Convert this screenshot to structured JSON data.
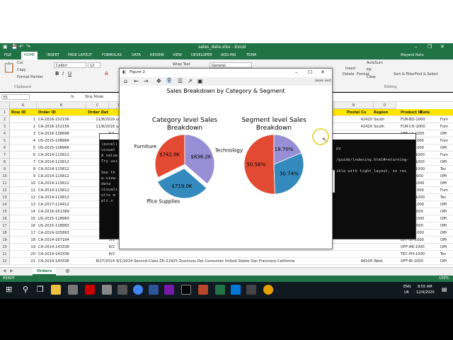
{
  "window": {
    "title": "sales_data.xlsx - Excel",
    "user": "Mayank Ratu"
  },
  "quick_access": {
    "excel_tab": "FILE"
  },
  "ribbon_tabs": [
    "FILE",
    "HOME",
    "INSERT",
    "PAGE LAYOUT",
    "FORMULAS",
    "DATA",
    "REVIEW",
    "VIEW",
    "DEVELOPER",
    "ADD-INS",
    "TEAM"
  ],
  "ribbon": {
    "cut": "Cut",
    "copy": "Copy",
    "format_painter": "Format Painter",
    "clipboard": "Clipboard",
    "font_name": "Calibri",
    "font_size": "12",
    "wrap_text": "Wrap Text",
    "number_format": "General",
    "autosum": "AutoSum",
    "fill": "Fill",
    "clear": "Clear",
    "sort_filter": "Sort & Filter",
    "find_select": "Find & Select",
    "editing": "Editing",
    "insert": "Insert",
    "delete": "Delete",
    "format": "Format"
  },
  "formula_bar": {
    "cell": "E1",
    "fx": "fx",
    "content": "Ship Mode"
  },
  "columns": [
    "A",
    "B",
    "C",
    "D",
    "E",
    "F",
    "G",
    "H",
    "I",
    "J",
    "K",
    "L",
    "M",
    "N",
    "O"
  ],
  "header_row": [
    "Row ID",
    "Order ID",
    "Order Dat",
    "",
    "",
    "",
    "",
    "",
    "",
    "",
    "Postal Co",
    "Region",
    "Product ID",
    "Cate"
  ],
  "rows": [
    {
      "n": "2",
      "id": "1",
      "order": "CA-2016-152156",
      "date": "11/8/2016",
      "tail": "ucky",
      "postal": "42420",
      "region": "South",
      "product": "FUR-BO-1000",
      "cat": "Furn"
    },
    {
      "n": "3",
      "id": "2",
      "order": "CA-2016-152156",
      "date": "11/8/2016",
      "tail": "ucky",
      "postal": "42420",
      "region": "South",
      "product": "FUR-CH-1000",
      "cat": "Furn"
    },
    {
      "n": "4",
      "id": "3",
      "order": "CA-2016-138688",
      "date": "6/1",
      "tail": "",
      "postal": "",
      "region": "",
      "product": "OFF-LA-1000",
      "cat": "Offi"
    },
    {
      "n": "5",
      "id": "4",
      "order": "US-2015-108966",
      "date": "10/1",
      "tail": "",
      "postal": "",
      "region": "",
      "product": "FUR-TA-1000",
      "cat": "Furn"
    },
    {
      "n": "6",
      "id": "5",
      "order": "US-2015-108966",
      "date": "10/1",
      "tail": "",
      "postal": "",
      "region": "",
      "product": "OFF-ST-1000",
      "cat": "Offi"
    },
    {
      "n": "7",
      "id": "6",
      "order": "CA-2014-115812",
      "date": "6/",
      "tail": "",
      "postal": "",
      "region": "",
      "product": "FUR-FU-1000",
      "cat": "Furn"
    },
    {
      "n": "8",
      "id": "7",
      "order": "CA-2014-115812",
      "date": "6/",
      "tail": "",
      "postal": "",
      "region": "",
      "product": "OFF-AR-1000",
      "cat": "Offi"
    },
    {
      "n": "9",
      "id": "8",
      "order": "CA-2014-115812",
      "date": "6/",
      "tail": "",
      "postal": "",
      "region": "",
      "product": "TEC-PH-1000",
      "cat": "Tec"
    },
    {
      "n": "10",
      "id": "9",
      "order": "CA-2014-115812",
      "date": "6/",
      "tail": "",
      "postal": "",
      "region": "",
      "product": "OFF-BI-1000",
      "cat": "Offi"
    },
    {
      "n": "11",
      "id": "10",
      "order": "CA-2014-115812",
      "date": "6/",
      "tail": "",
      "postal": "",
      "region": "",
      "product": "OFF-AP-1000",
      "cat": "Offi"
    },
    {
      "n": "12",
      "id": "11",
      "order": "CA-2014-115812",
      "date": "6/",
      "tail": "",
      "postal": "",
      "region": "",
      "product": "FUR-TA-1000",
      "cat": "Furn"
    },
    {
      "n": "13",
      "id": "12",
      "order": "CA-2014-115812",
      "date": "6/",
      "tail": "",
      "postal": "",
      "region": "",
      "product": "TEC-PH-1000",
      "cat": "Tec"
    },
    {
      "n": "14",
      "id": "13",
      "order": "CA-2017-114412",
      "date": "4/",
      "tail": "",
      "postal": "",
      "region": "",
      "product": "OFF-PA-1000",
      "cat": "Offi"
    },
    {
      "n": "15",
      "id": "14",
      "order": "CA-2016-161389",
      "date": "12/",
      "tail": "",
      "postal": "",
      "region": "",
      "product": "OFF-BI-1000",
      "cat": "Offi"
    },
    {
      "n": "16",
      "id": "15",
      "order": "US-2015-118983",
      "date": "11/2",
      "tail": "",
      "postal": "",
      "region": "",
      "product": "OFF-AP-1000",
      "cat": "Offi"
    },
    {
      "n": "17",
      "id": "16",
      "order": "US-2015-118983",
      "date": "11/2",
      "tail": "",
      "postal": "",
      "region": "",
      "product": "OFF-BI-1000",
      "cat": "Offi"
    },
    {
      "n": "18",
      "id": "17",
      "order": "CA-2014-105893",
      "date": "11/1",
      "tail": "",
      "postal": "",
      "region": "",
      "product": "OFF-ST-1000",
      "cat": "Offi"
    },
    {
      "n": "19",
      "id": "18",
      "order": "CA-2014-167164",
      "date": "5/1",
      "tail": "",
      "postal": "",
      "region": "",
      "product": "OFF-ST-1000",
      "cat": "Offi"
    },
    {
      "n": "20",
      "id": "19",
      "order": "CA-2014-143336",
      "date": "8/2",
      "tail": "",
      "postal": "",
      "region": "",
      "product": "OFF-AR-1000",
      "cat": "Offi"
    },
    {
      "n": "21",
      "id": "20",
      "order": "CA-2014-143336",
      "date": "8/2",
      "tail": "",
      "postal": "",
      "region": "",
      "product": "TEC-PH-1000",
      "cat": "Tec"
    },
    {
      "n": "22",
      "id": "21",
      "order": "CA-2014-143336",
      "date": "8/27/2014",
      "tail": "9/1/2014 Second Class ZD-21925    Zuschuss Dor Consumer    United States San Francisco California",
      "postal": "94109",
      "region": "West",
      "product": "OFF-BI-1000",
      "cat": "Offi"
    }
  ],
  "sheet_tab": "Orders",
  "status": {
    "ready": "READY",
    "zoom": "100%"
  },
  "taskbar": {
    "lang": "ENG",
    "region": "UK",
    "time": "8:55 AM",
    "date": "12/4/2020"
  },
  "console": {
    "lines": [
      "(excel)",
      "visual",
      "A value",
      "Try usi",
      "",
      "See th",
      "a-view-",
      "  data",
      "visuali",
      "ults m",
      "  plt.s"
    ],
    "right_lines": [
      "py",
      "",
      "/guide/indexing.html#returning-",
      "",
      "ible with tight_layout, so res"
    ]
  },
  "figure": {
    "window_title": "Figure 2",
    "mode": "zoom rect",
    "suptitle": "Sales Breakdown by Category & Segment"
  },
  "chart_data": [
    {
      "type": "pie",
      "title": "Category level Sales Breakdown",
      "labels": [
        "Furniture",
        "Office Supplies",
        "Technology"
      ],
      "values": [
        742.0,
        719.0,
        836.2
      ],
      "value_labels": [
        "$742.0K",
        "$719.0K",
        "$836.2K"
      ],
      "display_labels": [
        "Furniture",
        "ffice Supplies",
        "Technology"
      ],
      "colors": [
        "#e24a33",
        "#348abd",
        "#988ed5"
      ],
      "exploded": "Office Supplies"
    },
    {
      "type": "pie",
      "title": "Segment level Sales Breakdown",
      "values": [
        50.56,
        30.74,
        18.7
      ],
      "value_labels": [
        "50.56%",
        "30.74%",
        "18.70%"
      ],
      "colors": [
        "#e24a33",
        "#348abd",
        "#988ed5"
      ],
      "legend_labels": [
        "Co",
        "Co",
        ""
      ]
    }
  ]
}
